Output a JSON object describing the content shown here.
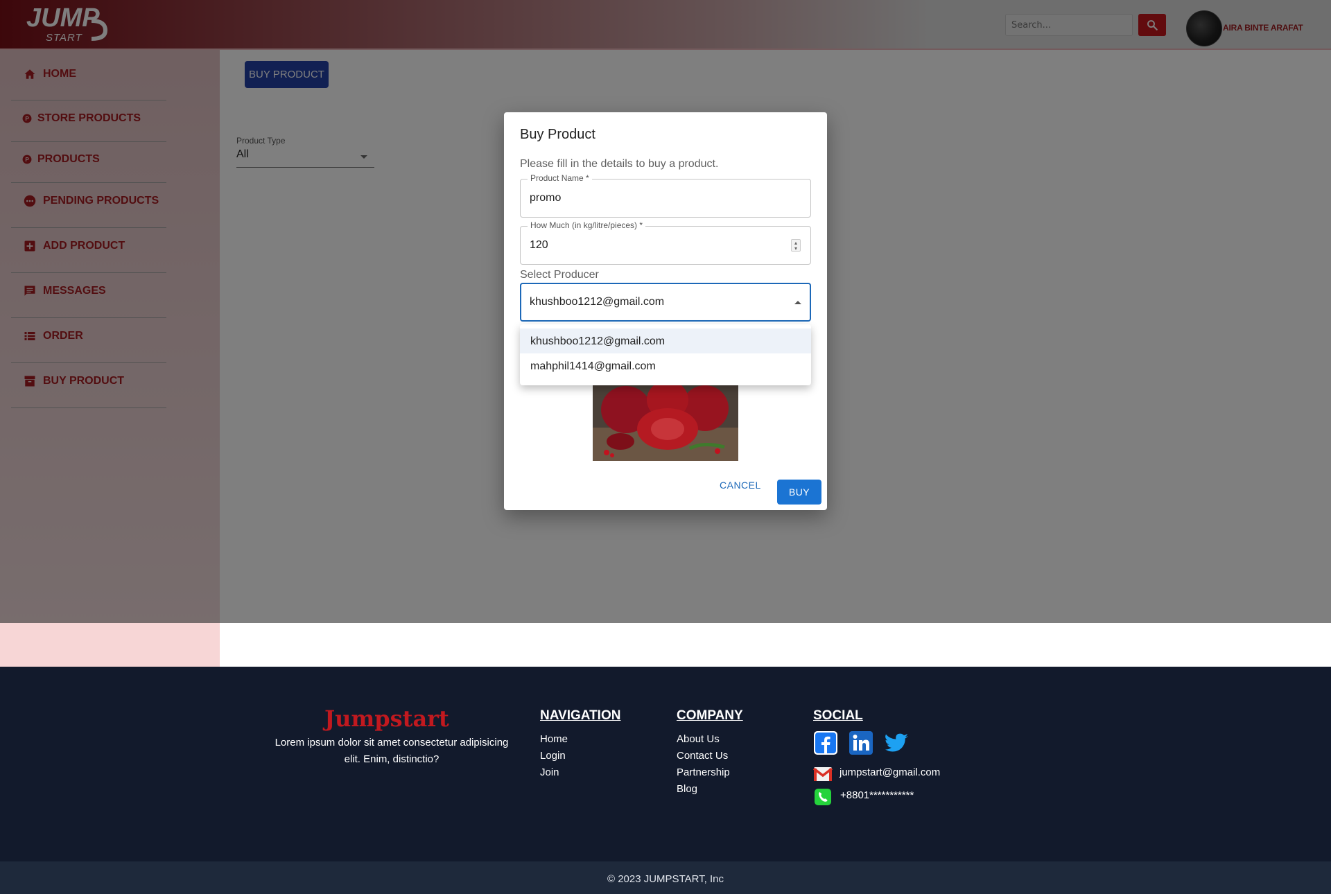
{
  "header": {
    "logo_text_top": "JUMP",
    "logo_text_bottom": "START",
    "search_placeholder": "Search...",
    "user_name": "AIRA BINTE ARAFAT"
  },
  "sidebar": {
    "items": [
      {
        "label": "HOME",
        "icon": "home-icon"
      },
      {
        "label": "STORE PRODUCTS",
        "icon": "p-circle-icon"
      },
      {
        "label": "PRODUCTS",
        "icon": "p-circle-icon"
      },
      {
        "label": "PENDING PRODUCTS",
        "icon": "pending-icon"
      },
      {
        "label": "ADD PRODUCT",
        "icon": "plus-box-icon"
      },
      {
        "label": "MESSAGES",
        "icon": "message-icon"
      },
      {
        "label": "ORDER",
        "icon": "list-icon"
      },
      {
        "label": "BUY PRODUCT",
        "icon": "archive-icon"
      }
    ]
  },
  "main": {
    "buy_button_label": "BUY PRODUCT",
    "product_type_label": "Product Type",
    "product_type_value": "All"
  },
  "dialog": {
    "title": "Buy Product",
    "description": "Please fill in the details to buy a product.",
    "product_name_label": "Product Name *",
    "product_name_value": "promo",
    "quantity_label": "How Much (in kg/litre/pieces) *",
    "quantity_value": "120",
    "producer_label": "Select Producer",
    "producer_value": "khushboo1212@gmail.com",
    "producer_options": [
      "khushboo1212@gmail.com",
      "mahphil1414@gmail.com"
    ],
    "cancel_label": "CANCEL",
    "buy_label": "BUY"
  },
  "footer": {
    "brand": "Jumpstart",
    "tagline": "Lorem ipsum dolor sit amet consectetur adipisicing elit. Enim, distinctio?",
    "navigation_heading": "NAVIGATION",
    "navigation_links": [
      "Home",
      "Login",
      "Join"
    ],
    "company_heading": "COMPANY",
    "company_links": [
      "About Us",
      "Contact Us",
      "Partnership",
      "Blog"
    ],
    "social_heading": "SOCIAL",
    "email": "jumpstart@gmail.com",
    "phone": "+8801***********",
    "copyright": "© 2023 JUMPSTART, Inc"
  },
  "colors": {
    "brand_red": "#c1191f",
    "sidebar_text": "#a51b20",
    "primary_blue": "#1b74d3",
    "button_navy": "#2340a6",
    "footer_bg": "#121a2c"
  }
}
